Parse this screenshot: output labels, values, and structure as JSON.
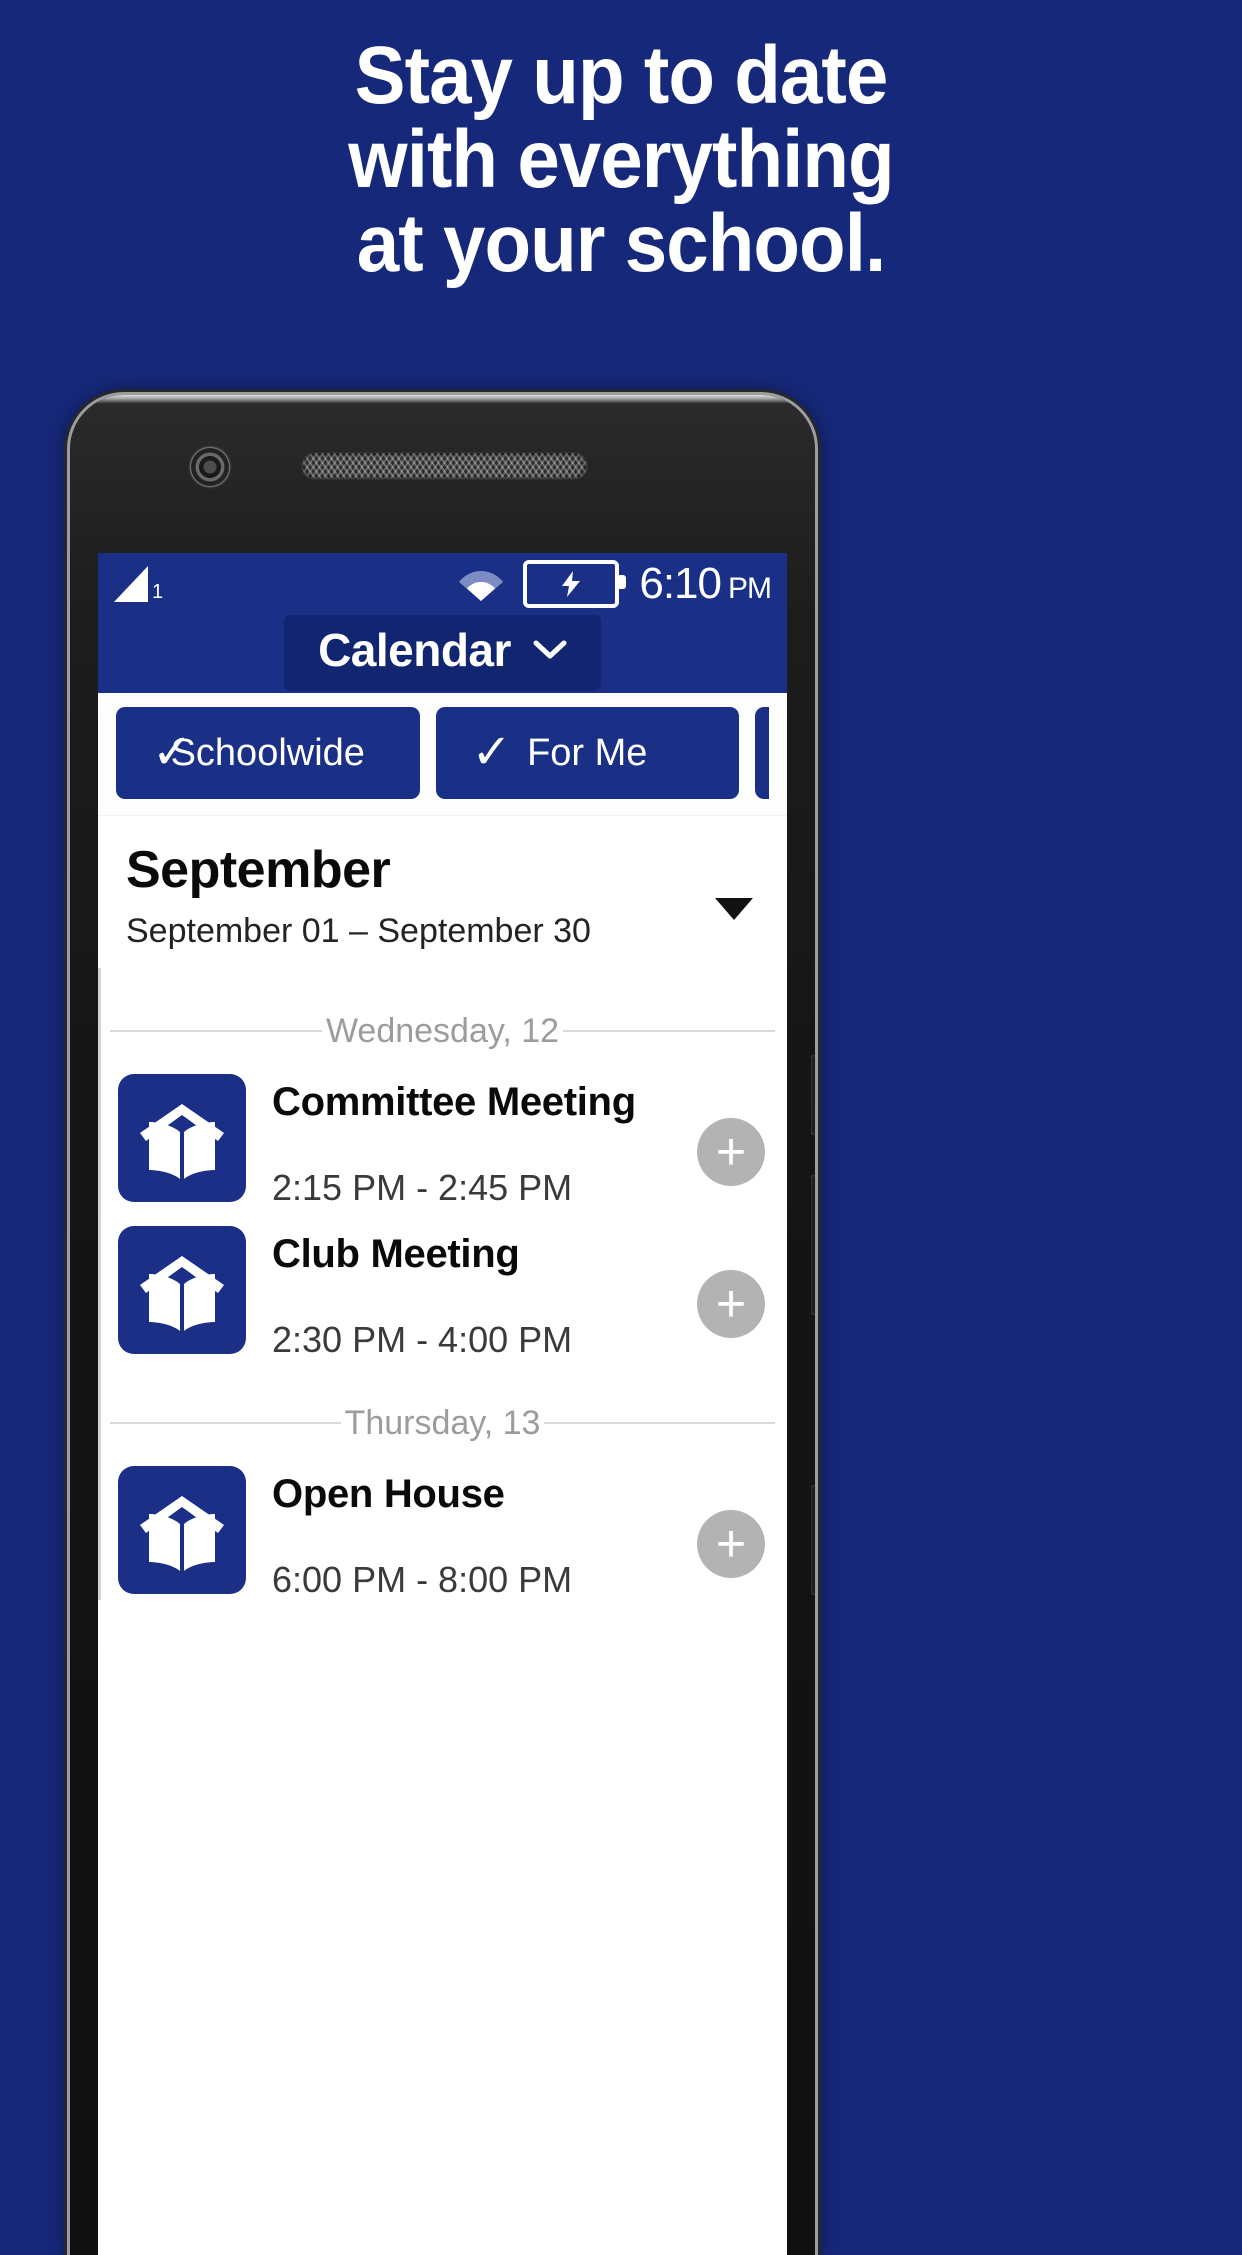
{
  "promo": {
    "lines": [
      "Stay up to date",
      "with everything",
      "at your school."
    ],
    "background_color": "#16287a",
    "text_color": "#ffffff"
  },
  "phone": {
    "status_bar": {
      "signal_icon": "signal-triangle-icon",
      "signal_index": "1",
      "wifi_icon": "wifi-icon",
      "battery_icon": "battery-charging-icon",
      "time": "6:10",
      "ampm": "PM",
      "background_color": "#1a2f86"
    },
    "app_bar": {
      "title": "Calendar",
      "dropdown_icon": "chevron-down-icon",
      "pill_color": "#112570"
    },
    "filters": [
      {
        "label": "Schoolwide",
        "check_icon": "check-icon",
        "checked": true
      },
      {
        "label": "For Me",
        "check_icon": "check-icon",
        "checked": true
      }
    ],
    "month_header": {
      "title": "September",
      "range": "September 01 – September 30",
      "caret_icon": "triangle-down-icon"
    },
    "groups": [
      {
        "day_label": "Wednesday, 12",
        "events": [
          {
            "title": "Committee Meeting",
            "time": "2:15 PM - 2:45 PM",
            "icon": "school-book-icon",
            "add_icon": "plus-icon"
          },
          {
            "title": "Club Meeting",
            "time": "2:30 PM - 4:00 PM",
            "icon": "school-book-icon",
            "add_icon": "plus-icon"
          }
        ]
      },
      {
        "day_label": "Thursday, 13",
        "events": [
          {
            "title": "Open House",
            "time": "6:00 PM - 8:00 PM",
            "icon": "school-book-icon",
            "add_icon": "plus-icon"
          }
        ]
      }
    ],
    "accent_color": "#1b2f86",
    "add_button_color": "#b3b3b3"
  }
}
